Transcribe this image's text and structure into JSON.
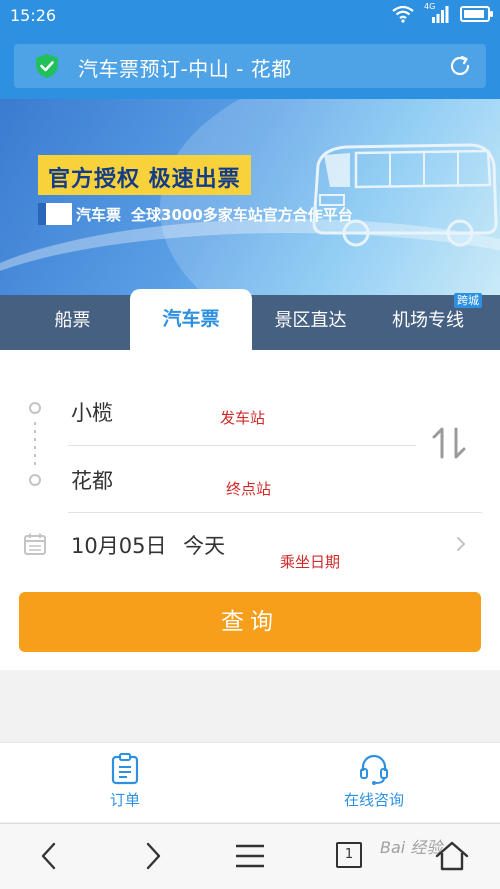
{
  "status": {
    "time": "15:26",
    "network": "4G",
    "icons": [
      "wifi-icon",
      "signal-icon",
      "battery-icon"
    ]
  },
  "address_bar": {
    "title": "汽车票预订-中山 - 花都",
    "security_icon": "shield-check-icon",
    "refresh_icon": "refresh-icon"
  },
  "banner": {
    "headline": "官方授权  极速出票",
    "brand": "汽车票",
    "subtitle": "全球3000多家车站官方合作平台"
  },
  "tabs": [
    {
      "label": "船票",
      "active": false
    },
    {
      "label": "汽车票",
      "active": true
    },
    {
      "label": "景区直达",
      "active": false
    },
    {
      "label": "机场专线",
      "active": false,
      "badge": "跨城"
    }
  ],
  "form": {
    "from": "小榄",
    "to": "花都",
    "date": "10月05日",
    "day": "今天",
    "search_label": "查询",
    "annotations": {
      "from": "发车站",
      "to": "终点站",
      "date": "乘坐日期"
    }
  },
  "app_nav": [
    {
      "label": "订单",
      "icon": "clipboard-icon"
    },
    {
      "label": "在线咨询",
      "icon": "headset-icon"
    }
  ],
  "browser_bar": {
    "tab_count": "1",
    "watermark": "Bai 经验"
  },
  "colors": {
    "primary": "#2e90e0",
    "accent": "#f79e1b",
    "annotation": "#d02a2a",
    "banner_tag": "#f7d23b"
  }
}
